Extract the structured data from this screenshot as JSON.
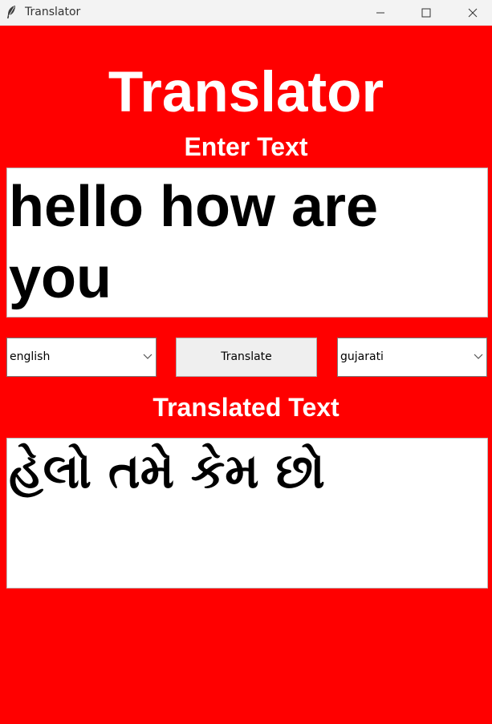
{
  "window": {
    "title": "Translator",
    "icon": "feather-icon"
  },
  "header": {
    "title": "Translator"
  },
  "input_section": {
    "label": "Enter Text",
    "value": "hello how are you"
  },
  "controls": {
    "source_language": "english",
    "translate_label": "Translate",
    "target_language": "gujarati"
  },
  "output_section": {
    "label": "Translated Text",
    "value": "હેલો તમે કેમ છો"
  },
  "colors": {
    "background": "#ff0000",
    "text_on_background": "#ffffff",
    "box_background": "#ffffff",
    "box_text": "#000000"
  }
}
